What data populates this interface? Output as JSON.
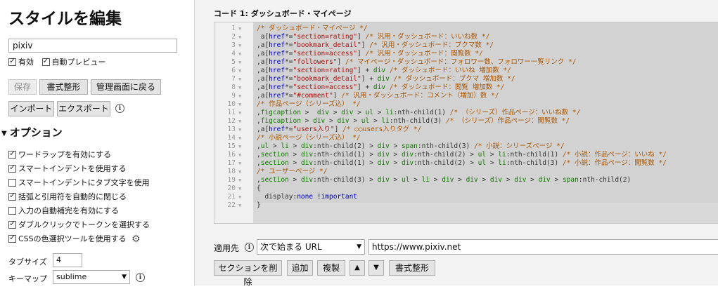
{
  "sidebar": {
    "title": "スタイルを編集",
    "name_value": "pixiv",
    "enabled_label": "有効",
    "autopreview_label": "自動プレビュー",
    "save_label": "保存",
    "format_label": "書式整形",
    "manage_label": "管理画面に戻る",
    "import_label": "インポート",
    "export_label": "エクスポート",
    "options_title": "オプション",
    "options": [
      {
        "label": "ワードラップを有効にする",
        "checked": true
      },
      {
        "label": "スマートインデントを使用する",
        "checked": true
      },
      {
        "label": "スマートインデントにタブ文字を使用",
        "checked": false
      },
      {
        "label": "括弧と引用符を自動的に閉じる",
        "checked": true
      },
      {
        "label": "入力の自動補完を有効にする",
        "checked": false
      },
      {
        "label": "ダブルクリックでトークンを選択する",
        "checked": true
      },
      {
        "label": "CSSの色選択ツールを使用する",
        "checked": true
      }
    ],
    "tabsize_label": "タブサイズ",
    "tabsize_value": "4",
    "keymap_label": "キーマップ",
    "keymap_value": "sublime"
  },
  "editor": {
    "code_title": "コード 1: ダッシュボード・マイページ",
    "lines": [
      [
        [
          "c",
          "/* ダッシュボード・マイページ */"
        ]
      ],
      [
        [
          "d",
          " a["
        ],
        [
          "k",
          "href"
        ],
        [
          "d",
          "*="
        ],
        [
          "s",
          "\"section=rating\""
        ],
        [
          "d",
          "] "
        ],
        [
          "c",
          "/* 汎用・ダッシュボード：いいね数 */"
        ]
      ],
      [
        [
          "d",
          ",a["
        ],
        [
          "k",
          "href"
        ],
        [
          "d",
          "*="
        ],
        [
          "s",
          "\"bookmark_detail\""
        ],
        [
          "d",
          "] "
        ],
        [
          "c",
          "/* 汎用・ダッシュボード：ブクマ数 */"
        ]
      ],
      [
        [
          "d",
          ",a["
        ],
        [
          "k",
          "href"
        ],
        [
          "d",
          "*="
        ],
        [
          "s",
          "\"section=access\""
        ],
        [
          "d",
          "] "
        ],
        [
          "c",
          "/* 汎用・ダッシュボード：閲覧数 */"
        ]
      ],
      [
        [
          "d",
          ",a["
        ],
        [
          "k",
          "href"
        ],
        [
          "d",
          "*="
        ],
        [
          "s",
          "\"followers\""
        ],
        [
          "d",
          "] "
        ],
        [
          "c",
          "/* マイページ・ダッシュボード：フォロワー数、フォロワー一覧リンク */"
        ]
      ],
      [
        [
          "d",
          ",a["
        ],
        [
          "k",
          "href"
        ],
        [
          "d",
          "*="
        ],
        [
          "s",
          "\"section=rating\""
        ],
        [
          "d",
          "] + "
        ],
        [
          "t",
          "div"
        ],
        [
          "d",
          " "
        ],
        [
          "c",
          "/* ダッシュボード：いいね 増加数 */"
        ]
      ],
      [
        [
          "d",
          ",a["
        ],
        [
          "k",
          "href"
        ],
        [
          "d",
          "*="
        ],
        [
          "s",
          "\"bookmark_detail\""
        ],
        [
          "d",
          "] + "
        ],
        [
          "t",
          "div"
        ],
        [
          "d",
          " "
        ],
        [
          "c",
          "/* ダッシュボード：ブクマ 増加数 */"
        ]
      ],
      [
        [
          "d",
          ",a["
        ],
        [
          "k",
          "href"
        ],
        [
          "d",
          "*="
        ],
        [
          "s",
          "\"section=access\""
        ],
        [
          "d",
          "] + "
        ],
        [
          "t",
          "div"
        ],
        [
          "d",
          " "
        ],
        [
          "c",
          "/* ダッシュボード：閲覧 増加数 */"
        ]
      ],
      [
        [
          "d",
          ",a["
        ],
        [
          "k",
          "href"
        ],
        [
          "d",
          "*="
        ],
        [
          "s",
          "\"#comment\""
        ],
        [
          "d",
          "] "
        ],
        [
          "c",
          "/* 汎用・ダッシュボード：コメント（増加）数 */"
        ]
      ],
      [
        [
          "c",
          "/* 作品ページ（シリーズ込） */"
        ]
      ],
      [
        [
          "d",
          ","
        ],
        [
          "t",
          "figcaption"
        ],
        [
          "d",
          " >  "
        ],
        [
          "t",
          "div"
        ],
        [
          "d",
          " > "
        ],
        [
          "t",
          "div"
        ],
        [
          "d",
          " > "
        ],
        [
          "t",
          "ul"
        ],
        [
          "d",
          " > "
        ],
        [
          "t",
          "li"
        ],
        [
          "d",
          ":nth-child(1) "
        ],
        [
          "c",
          "/* （シリーズ）作品ページ：いいね数 */"
        ]
      ],
      [
        [
          "d",
          ","
        ],
        [
          "t",
          "figcaption"
        ],
        [
          "d",
          " > "
        ],
        [
          "t",
          "div"
        ],
        [
          "d",
          " > "
        ],
        [
          "t",
          "div"
        ],
        [
          "d",
          " > "
        ],
        [
          "t",
          "ul"
        ],
        [
          "d",
          " > "
        ],
        [
          "t",
          "li"
        ],
        [
          "d",
          ":nth-child(3) "
        ],
        [
          "c",
          "/* （シリーズ）作品ページ：閲覧数 */"
        ]
      ],
      [
        [
          "d",
          ",a["
        ],
        [
          "k",
          "href"
        ],
        [
          "d",
          "*="
        ],
        [
          "s",
          "\"users入り\""
        ],
        [
          "d",
          "] "
        ],
        [
          "c",
          "/* ○○users入りタグ */"
        ]
      ],
      [
        [
          "c",
          "/* 小説ページ（シリーズ込） */"
        ]
      ],
      [
        [
          "d",
          ","
        ],
        [
          "t",
          "ul"
        ],
        [
          "d",
          " > "
        ],
        [
          "t",
          "li"
        ],
        [
          "d",
          " > "
        ],
        [
          "t",
          "div"
        ],
        [
          "d",
          ":nth-child(2) > "
        ],
        [
          "t",
          "div"
        ],
        [
          "d",
          " > "
        ],
        [
          "t",
          "span"
        ],
        [
          "d",
          ":nth-child(3) "
        ],
        [
          "c",
          "/* 小説：シリーズページ */"
        ]
      ],
      [
        [
          "d",
          ","
        ],
        [
          "t",
          "section"
        ],
        [
          "d",
          " > "
        ],
        [
          "t",
          "div"
        ],
        [
          "d",
          ":nth-child(1) > "
        ],
        [
          "t",
          "div"
        ],
        [
          "d",
          " > "
        ],
        [
          "t",
          "div"
        ],
        [
          "d",
          ":nth-child(2) > "
        ],
        [
          "t",
          "ul"
        ],
        [
          "d",
          " > "
        ],
        [
          "t",
          "li"
        ],
        [
          "d",
          ":nth-child(1) "
        ],
        [
          "c",
          "/* 小説：作品ページ：いいね */"
        ]
      ],
      [
        [
          "d",
          ","
        ],
        [
          "t",
          "section"
        ],
        [
          "d",
          " > "
        ],
        [
          "t",
          "div"
        ],
        [
          "d",
          ":nth-child(1) > "
        ],
        [
          "t",
          "div"
        ],
        [
          "d",
          " > "
        ],
        [
          "t",
          "div"
        ],
        [
          "d",
          ":nth-child(2) > "
        ],
        [
          "t",
          "ul"
        ],
        [
          "d",
          " > "
        ],
        [
          "t",
          "li"
        ],
        [
          "d",
          ":nth-child(3) "
        ],
        [
          "c",
          "/* 小説：作品ページ：閲覧数 */"
        ]
      ],
      [
        [
          "c",
          "/* ユーザーページ */"
        ]
      ],
      [
        [
          "d",
          ","
        ],
        [
          "t",
          "section"
        ],
        [
          "d",
          " > "
        ],
        [
          "t",
          "div"
        ],
        [
          "d",
          ":nth-child(3) > "
        ],
        [
          "t",
          "div"
        ],
        [
          "d",
          " > "
        ],
        [
          "t",
          "ul"
        ],
        [
          "d",
          " > "
        ],
        [
          "t",
          "li"
        ],
        [
          "d",
          " > "
        ],
        [
          "t",
          "div"
        ],
        [
          "d",
          " > "
        ],
        [
          "t",
          "div"
        ],
        [
          "d",
          " > "
        ],
        [
          "t",
          "div"
        ],
        [
          "d",
          " > "
        ],
        [
          "t",
          "div"
        ],
        [
          "d",
          " > "
        ],
        [
          "t",
          "div"
        ],
        [
          "d",
          " > "
        ],
        [
          "t",
          "span"
        ],
        [
          "d",
          ":nth-child(2)"
        ]
      ],
      [
        [
          "d",
          "{"
        ]
      ],
      [
        [
          "d",
          "  display:"
        ],
        [
          "k",
          "none"
        ],
        [
          "d",
          " "
        ],
        [
          "k",
          "!important"
        ]
      ],
      [
        [
          "d",
          "}"
        ]
      ]
    ]
  },
  "apply": {
    "label": "適用先",
    "type_value": "次で始まる URL",
    "url_value": "https://www.pixiv.net",
    "delete_label": "セクションを削除",
    "add_label": "追加",
    "dup_label": "複製",
    "up_label": "▲",
    "down_label": "▼",
    "format_label": "書式整形"
  }
}
